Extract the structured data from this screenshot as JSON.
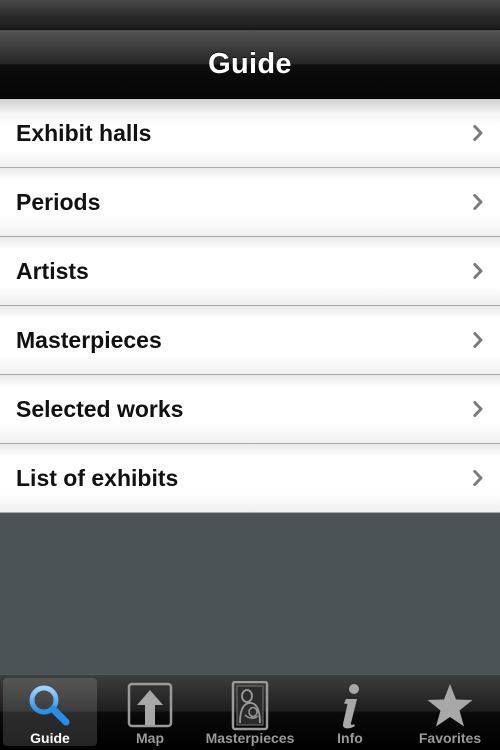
{
  "nav": {
    "title": "Guide"
  },
  "menu": {
    "items": [
      {
        "label": "Exhibit halls"
      },
      {
        "label": "Periods"
      },
      {
        "label": "Artists"
      },
      {
        "label": "Masterpieces"
      },
      {
        "label": "Selected works"
      },
      {
        "label": "List of exhibits"
      }
    ],
    "chevron_icon": "chevron-right-icon"
  },
  "tabbar": {
    "selected": "Guide",
    "tabs": [
      {
        "label": "Guide",
        "icon": "magnifier-icon"
      },
      {
        "label": "Map",
        "icon": "map-arrow-icon"
      },
      {
        "label": "Masterpieces",
        "icon": "painting-icon"
      },
      {
        "label": "Info",
        "icon": "info-icon"
      },
      {
        "label": "Favorites",
        "icon": "star-icon"
      }
    ]
  },
  "colors": {
    "background": "#4b5256",
    "accent": "#2a8ee8",
    "tab_inactive": "#9a9a9a"
  }
}
